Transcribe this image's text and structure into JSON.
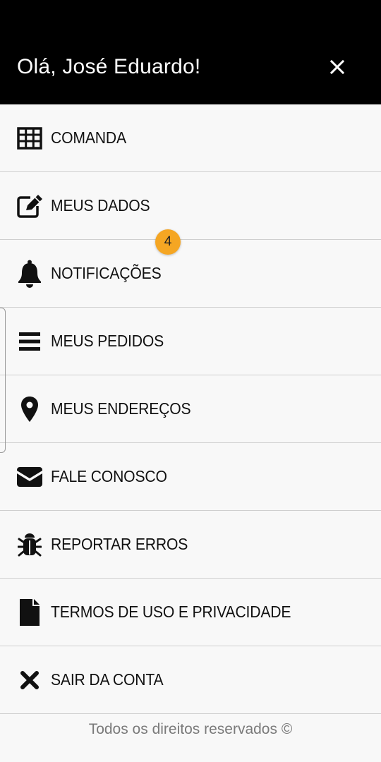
{
  "header": {
    "greeting": "Olá, José Eduardo!",
    "close_icon": "close-icon"
  },
  "menu": {
    "items": [
      {
        "label": "COMANDA",
        "icon": "table-grid-icon"
      },
      {
        "label": "MEUS DADOS",
        "icon": "edit-icon"
      },
      {
        "label": "NOTIFICAÇÕES",
        "icon": "bell-icon"
      },
      {
        "label": "MEUS PEDIDOS",
        "icon": "list-icon"
      },
      {
        "label": "MEUS ENDEREÇOS",
        "icon": "map-pin-icon"
      },
      {
        "label": "FALE CONOSCO",
        "icon": "envelope-icon"
      },
      {
        "label": "REPORTAR ERROS",
        "icon": "bug-icon"
      },
      {
        "label": "TERMOS DE USO E PRIVACIDADE",
        "icon": "document-icon"
      },
      {
        "label": "SAIR DA CONTA",
        "icon": "x-mark-icon"
      }
    ],
    "notifications_badge": "4"
  },
  "footer": {
    "text": "Todos os direitos reservados ©"
  },
  "colors": {
    "header_bg": "#000000",
    "background": "#f8f8f8",
    "badge": "#f5a623",
    "divider": "#cfcfcf"
  }
}
